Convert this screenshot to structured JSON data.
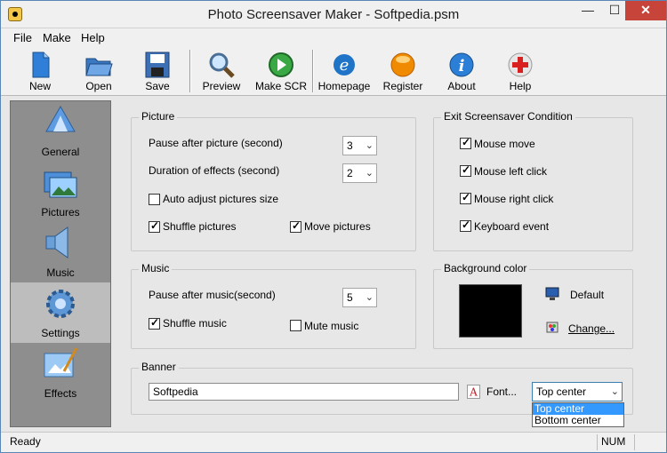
{
  "window": {
    "title": "Photo Screensaver Maker - Softpedia.psm",
    "close_label": "✕",
    "min_label": "—",
    "max_label": "☐"
  },
  "menu": [
    "File",
    "Make",
    "Help"
  ],
  "toolbar": [
    {
      "label": "New",
      "icon": "new-document-icon"
    },
    {
      "label": "Open",
      "icon": "open-folder-icon"
    },
    {
      "label": "Save",
      "icon": "save-disk-icon"
    },
    {
      "label": "Preview",
      "icon": "magnifier-icon"
    },
    {
      "label": "Make SCR",
      "icon": "play-icon"
    },
    {
      "label": "Homepage",
      "icon": "internet-explorer-icon"
    },
    {
      "label": "Register",
      "icon": "orange-orb-icon"
    },
    {
      "label": "About",
      "icon": "info-icon"
    },
    {
      "label": "Help",
      "icon": "help-cross-icon"
    }
  ],
  "sidebar": [
    {
      "label": "General",
      "icon": "general-icon"
    },
    {
      "label": "Pictures",
      "icon": "pictures-icon"
    },
    {
      "label": "Music",
      "icon": "music-speaker-icon"
    },
    {
      "label": "Settings",
      "icon": "settings-gear-icon",
      "active": true
    },
    {
      "label": "Effects",
      "icon": "effects-brush-icon"
    }
  ],
  "picture": {
    "title": "Picture",
    "pause_label": "Pause after picture (second)",
    "pause_value": "3",
    "duration_label": "Duration of effects (second)",
    "duration_value": "2",
    "auto_adjust_label": "Auto adjust pictures size",
    "auto_adjust_checked": false,
    "shuffle_label": "Shuffle pictures",
    "shuffle_checked": true,
    "move_label": "Move pictures",
    "move_checked": true
  },
  "exit": {
    "title": "Exit Screensaver Condition",
    "items": [
      {
        "label": "Mouse move",
        "checked": true
      },
      {
        "label": "Mouse left click",
        "checked": true
      },
      {
        "label": "Mouse right click",
        "checked": true
      },
      {
        "label": "Keyboard event",
        "checked": true
      }
    ]
  },
  "music": {
    "title": "Music",
    "pause_label": "Pause after music(second)",
    "pause_value": "5",
    "shuffle_label": "Shuffle music",
    "shuffle_checked": true,
    "mute_label": "Mute music",
    "mute_checked": false
  },
  "background": {
    "title": "Background color",
    "color": "#000000",
    "default_label": "Default",
    "change_label": "Change..."
  },
  "banner": {
    "title": "Banner",
    "text_value": "Softpedia",
    "font_label": "Font...",
    "position_value": "Top center",
    "options": [
      "Top center",
      "Bottom center"
    ],
    "highlighted_option": 0
  },
  "status": {
    "text": "Ready",
    "num": "NUM"
  },
  "colors": {
    "accent": "#3399ff",
    "close": "#c7443b"
  }
}
